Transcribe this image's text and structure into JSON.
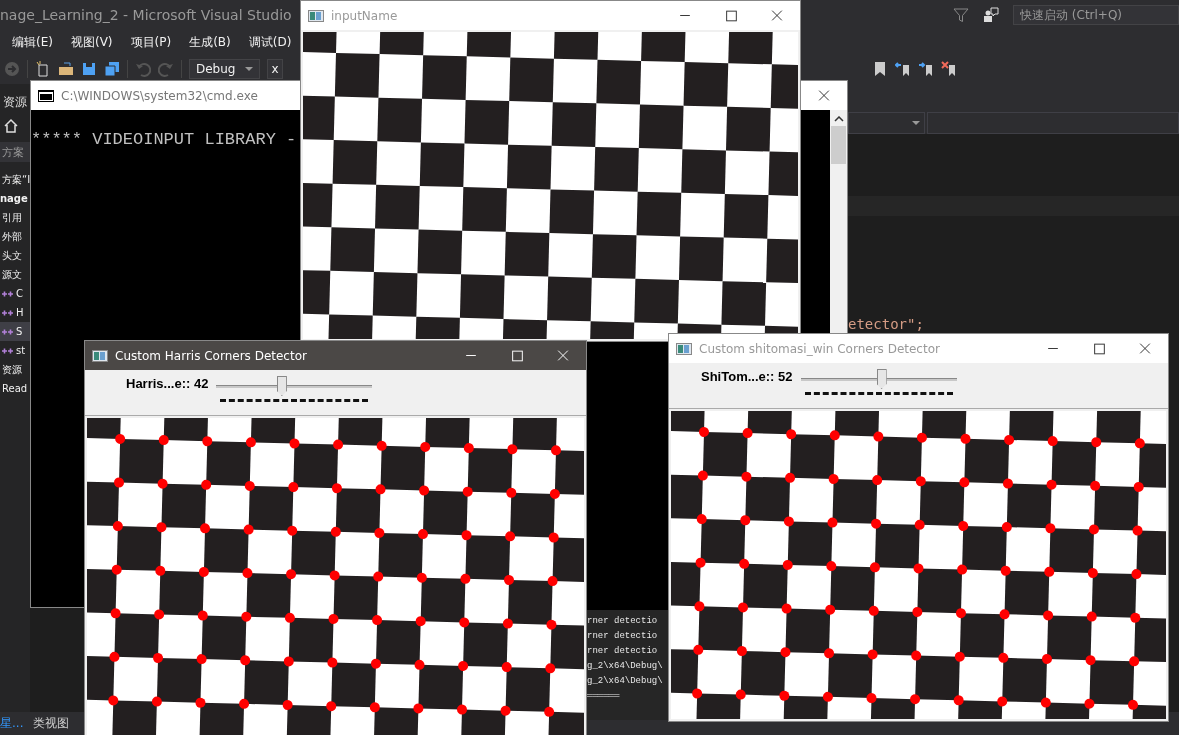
{
  "visual_studio": {
    "title": "nage_Learning_2 - Microsoft Visual Studio",
    "quick_launch": {
      "placeholder": "快速启动 (Ctrl+Q)"
    },
    "menu": [
      "编辑(E)",
      "视图(V)",
      "项目(P)",
      "生成(B)",
      "调试(D)"
    ],
    "toolbar": {
      "configuration": "Debug",
      "platform": "x"
    },
    "solution_explorer": {
      "title": "资源",
      "search": {
        "placeholder": "方案"
      },
      "items": [
        {
          "kind": "text",
          "text": "方案“I",
          "selected": false
        },
        {
          "kind": "project",
          "text": "nage",
          "selected": false
        },
        {
          "kind": "folder",
          "text": "引用",
          "selected": false
        },
        {
          "kind": "folder",
          "text": "外部",
          "selected": false
        },
        {
          "kind": "folder",
          "text": "头文",
          "selected": false
        },
        {
          "kind": "folder",
          "text": "源文",
          "selected": false
        },
        {
          "kind": "cpp",
          "text": "C",
          "selected": false
        },
        {
          "kind": "cpp",
          "text": "H",
          "selected": false
        },
        {
          "kind": "cpp",
          "text": "S",
          "selected": true
        },
        {
          "kind": "cpp",
          "text": "st",
          "selected": false
        },
        {
          "kind": "folder",
          "text": "资源",
          "selected": false
        },
        {
          "kind": "file",
          "text": "Read",
          "selected": false
        }
      ]
    },
    "code_line": "etector\";",
    "bottom_tabs": [
      {
        "label": "星...",
        "selected": true
      },
      {
        "label": "类视图",
        "selected": false
      }
    ]
  },
  "windows": [
    {
      "kind": "console",
      "title": "C:\\WINDOWS\\system32\\cmd.exe",
      "active": false,
      "lines": [
        "***** VIDEOINPUT LIBRARY - "
      ]
    },
    {
      "kind": "image",
      "title": "inputName",
      "active": false,
      "corner_marks": false
    },
    {
      "kind": "trackbar",
      "title": "Custom Harris Corners Detector",
      "active": true,
      "corner_marks": true,
      "trackbar": {
        "label": "Harris...e:: 42",
        "level": 0.42
      }
    },
    {
      "kind": "trackbar",
      "title": "Custom shitomasi_win Corners Detector",
      "active": false,
      "corner_marks": true,
      "trackbar": {
        "label": "ShiTom...e:: 52",
        "level": 0.52
      }
    }
  ],
  "console_output": {
    "lines": [
      "rner detectio",
      "rner detectio",
      "rner detectio",
      "g_2\\x64\\Debug\\",
      "g_2\\x64\\Debug\\",
      "══════"
    ]
  }
}
